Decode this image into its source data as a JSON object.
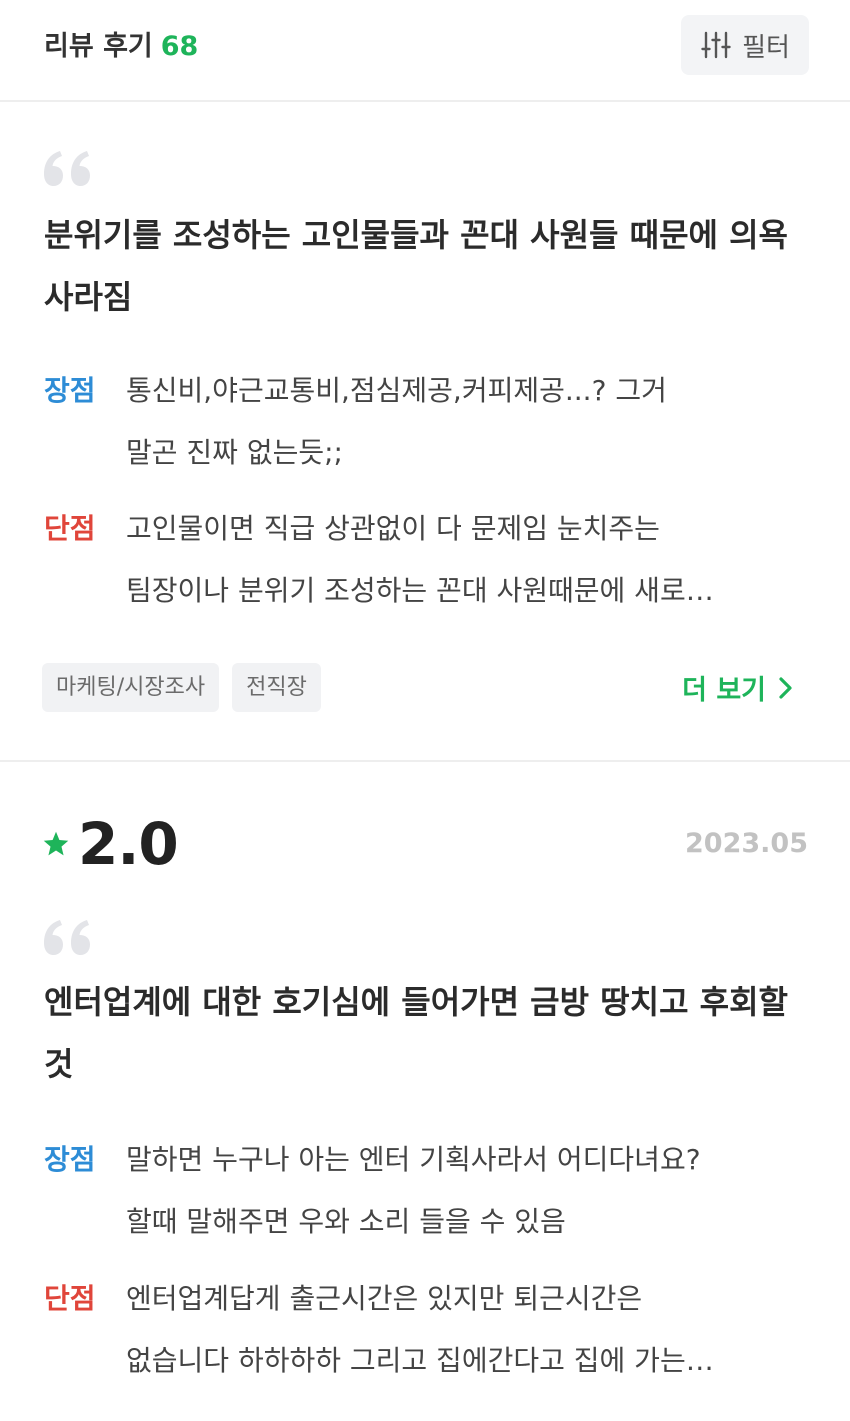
{
  "header": {
    "title": "리뷰 후기",
    "count": "68",
    "filter_label": "필터"
  },
  "reviews": [
    {
      "title": "분위기를 조성하는 고인물들과 꼰대 사원들 때문에 의욕 사라짐",
      "pros_label": "장점",
      "pros": "통신비,야근교통비,점심제공,커피제공...? 그거\n말곤 진짜 없는듯;;",
      "cons_label": "단점",
      "cons": "고인물이면 직급 상관없이 다 문제임 눈치주는\n팀장이나 분위기 조성하는 꼰대 사원때문에 새로…",
      "tags": [
        "마케팅/시장조사",
        "전직장"
      ],
      "more_label": "더 보기"
    },
    {
      "rating": "2.0",
      "date": "2023.05",
      "title": "엔터업계에 대한 호기심에 들어가면 금방 땅치고 후회할 것",
      "pros_label": "장점",
      "pros": "말하면 누구나 아는 엔터 기획사라서 어디다녀요?\n할때 말해주면 우와 소리 들을 수 있음",
      "cons_label": "단점",
      "cons": "엔터업계답게 출근시간은 있지만 퇴근시간은\n없습니다 하하하하 그리고 집에간다고 집에 가는…"
    }
  ],
  "colors": {
    "accent_green": "#1eb45a",
    "pros_blue": "#2d8cd6",
    "cons_red": "#e0453a"
  },
  "icons": {
    "filter": "sliders-icon",
    "quote": "quote-icon",
    "star": "star-icon",
    "chevron": "chevron-right-icon"
  }
}
